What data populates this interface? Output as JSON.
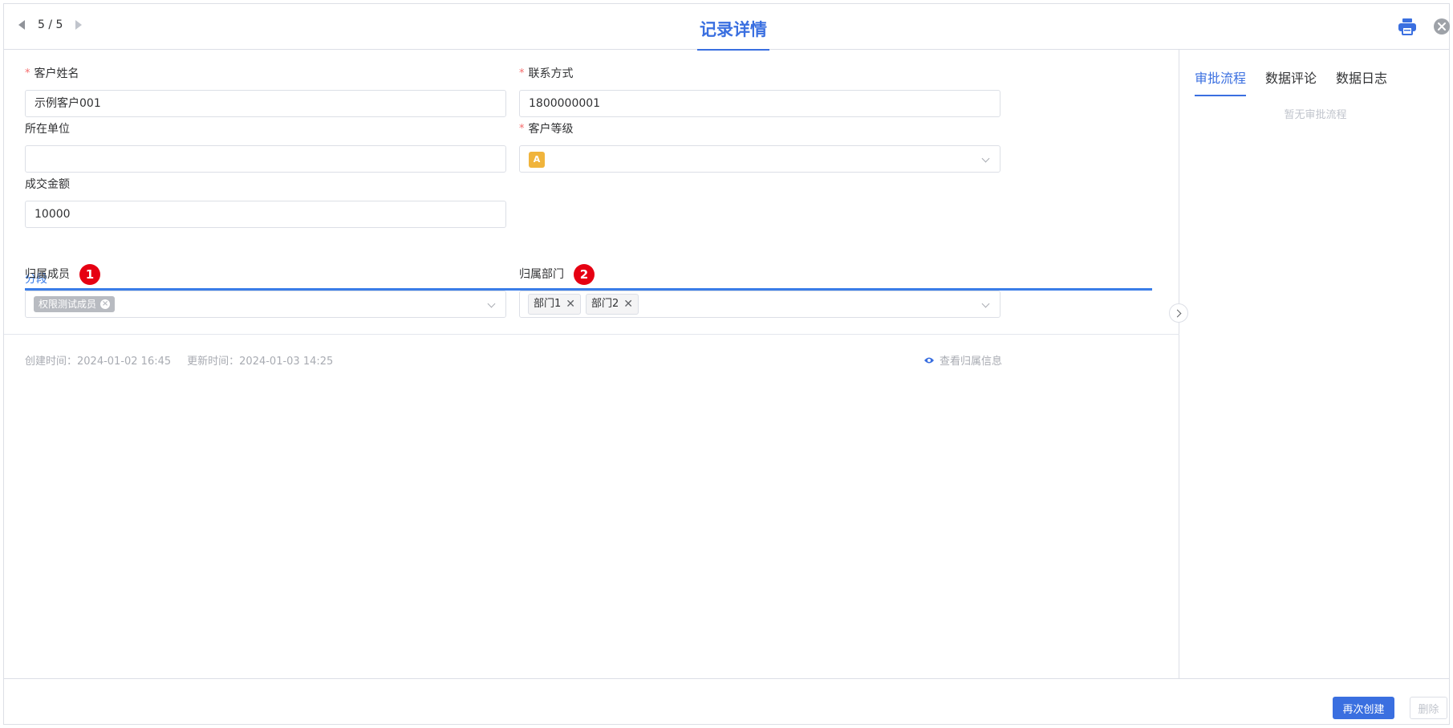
{
  "header": {
    "pager": "5 / 5",
    "title": "记录详情"
  },
  "form": {
    "customer_name": {
      "label": "客户姓名",
      "required": true,
      "value": "示例客户001"
    },
    "contact": {
      "label": "联系方式",
      "required": true,
      "value": "1800000001"
    },
    "company": {
      "label": "所在单位",
      "required": false,
      "value": ""
    },
    "grade": {
      "label": "客户等级",
      "required": true,
      "value": "A",
      "badge_color": "#f0b43c"
    },
    "amount": {
      "label": "成交金额",
      "required": false,
      "value": "10000"
    },
    "section_title": "分段",
    "owner": {
      "label": "归属成员",
      "badge": "1",
      "tags": [
        "权限测试成员"
      ]
    },
    "dept": {
      "label": "归属部门",
      "badge": "2",
      "tags": [
        "部门1",
        "部门2"
      ]
    }
  },
  "meta": {
    "created": "创建时间：2024-01-02 16:45",
    "updated": "更新时间：2024-01-03 14:25",
    "view_owner": "查看归属信息"
  },
  "side": {
    "tabs": [
      "审批流程",
      "数据评论",
      "数据日志"
    ],
    "empty_text": "暂无审批流程"
  },
  "footer": {
    "recreate": "再次创建",
    "delete": "删除"
  },
  "colors": {
    "primary": "#3a6fe0",
    "required": "#f56c6c",
    "annotation_badge": "#e60012"
  }
}
